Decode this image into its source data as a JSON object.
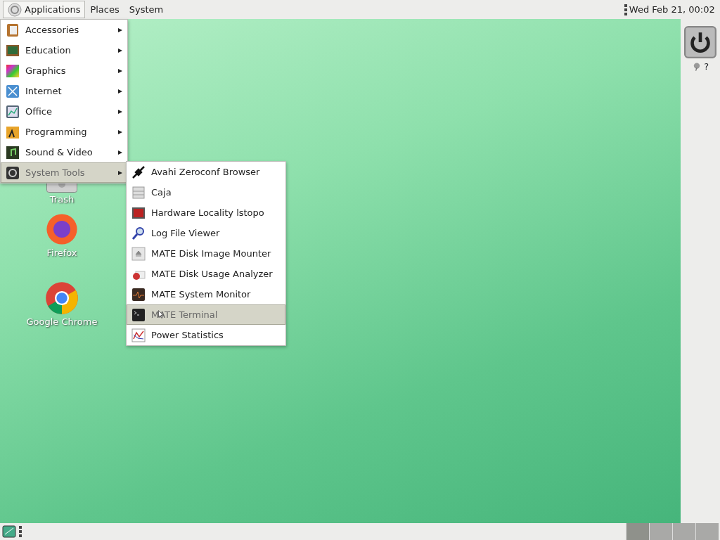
{
  "top_panel": {
    "menus": [
      {
        "label": "Applications",
        "selected": true
      },
      {
        "label": "Places",
        "selected": false
      },
      {
        "label": "System",
        "selected": false
      }
    ],
    "clock": "Wed Feb 21, 00:02"
  },
  "applications_menu": {
    "items": [
      {
        "label": "Accessories",
        "selected": false
      },
      {
        "label": "Education",
        "selected": false
      },
      {
        "label": "Graphics",
        "selected": false
      },
      {
        "label": "Internet",
        "selected": false
      },
      {
        "label": "Office",
        "selected": false
      },
      {
        "label": "Programming",
        "selected": false
      },
      {
        "label": "Sound & Video",
        "selected": false
      },
      {
        "label": "System Tools",
        "selected": true
      }
    ]
  },
  "system_tools_menu": {
    "items": [
      {
        "label": "Avahi Zeroconf Browser",
        "selected": false
      },
      {
        "label": "Caja",
        "selected": false
      },
      {
        "label": "Hardware Locality lstopo",
        "selected": false
      },
      {
        "label": "Log File Viewer",
        "selected": false
      },
      {
        "label": "MATE Disk Image Mounter",
        "selected": false
      },
      {
        "label": "MATE Disk Usage Analyzer",
        "selected": false
      },
      {
        "label": "MATE System Monitor",
        "selected": false
      },
      {
        "label": "MATE Terminal",
        "selected": true
      },
      {
        "label": "Power Statistics",
        "selected": false
      }
    ]
  },
  "desktop_icons": [
    {
      "label": "Trash"
    },
    {
      "label": "Firefox"
    },
    {
      "label": "Google Chrome"
    }
  ],
  "weather": {
    "text": "?"
  },
  "workspaces": [
    {
      "selected": true
    },
    {
      "selected": false
    },
    {
      "selected": false
    },
    {
      "selected": false
    }
  ]
}
